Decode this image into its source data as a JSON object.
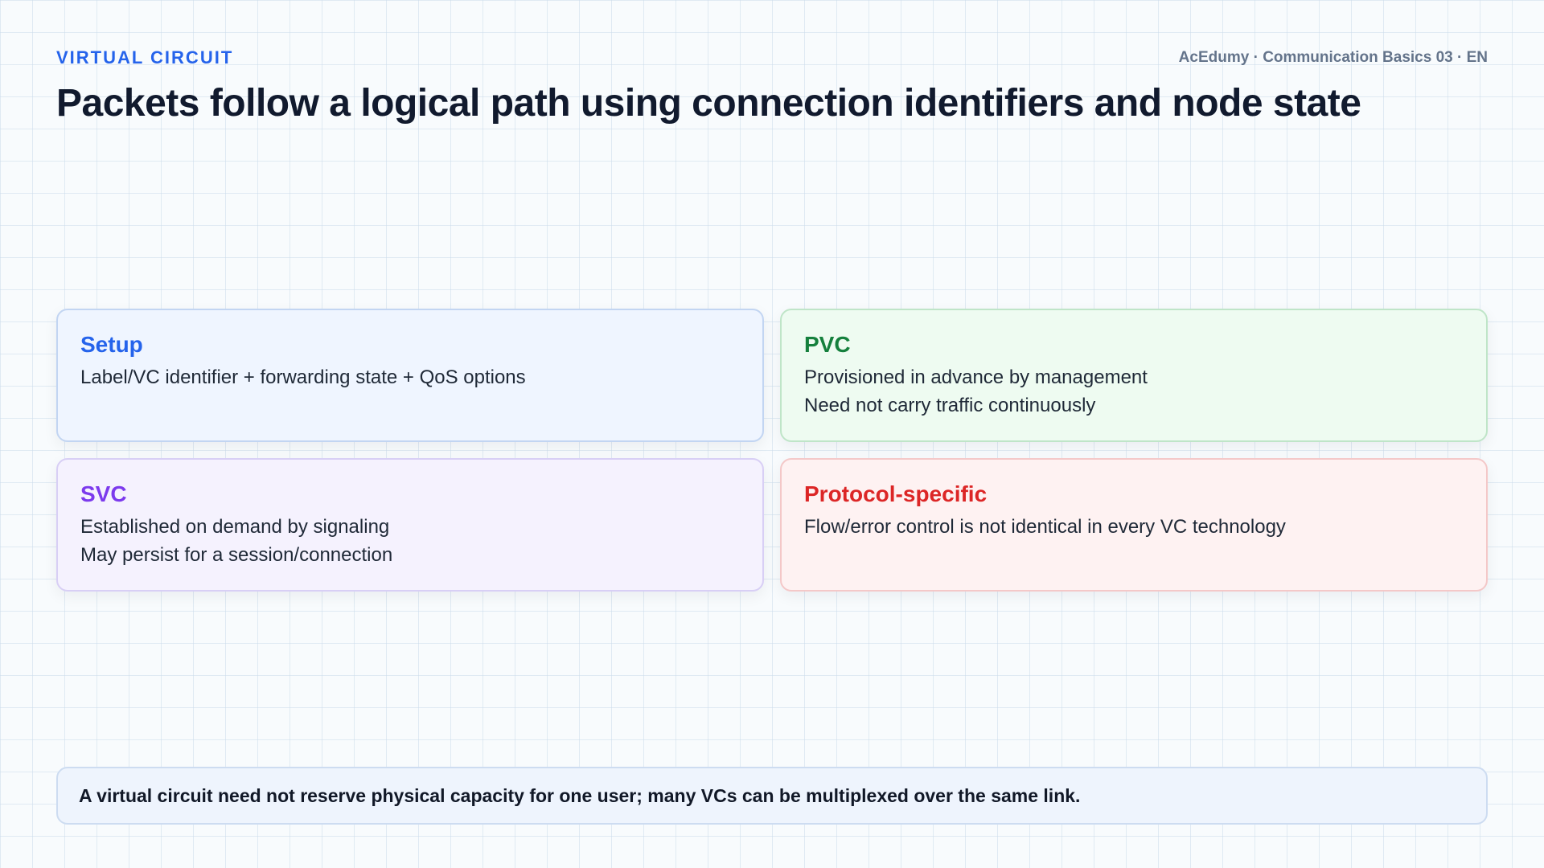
{
  "header": {
    "kicker": "VIRTUAL CIRCUIT",
    "meta": "AcEdumy · Communication Basics 03 · EN",
    "title": "Packets follow a logical path using connection identifiers and node state"
  },
  "cards": [
    {
      "title": "Setup",
      "title_color": "#2563eb",
      "lines": [
        "Label/VC identifier + forwarding state + QoS options"
      ]
    },
    {
      "title": "PVC",
      "title_color": "#15803d",
      "lines": [
        "Provisioned in advance by management",
        "Need not carry traffic continuously"
      ]
    },
    {
      "title": "SVC",
      "title_color": "#7c3aed",
      "lines": [
        "Established on demand by signaling",
        "May persist for a session/connection"
      ]
    },
    {
      "title": "Protocol-specific",
      "title_color": "#dc2626",
      "lines": [
        "Flow/error control is not identical in every VC technology"
      ]
    }
  ],
  "footer": {
    "note": "A virtual circuit need not reserve physical capacity for one user; many VCs can be multiplexed over the same link."
  }
}
